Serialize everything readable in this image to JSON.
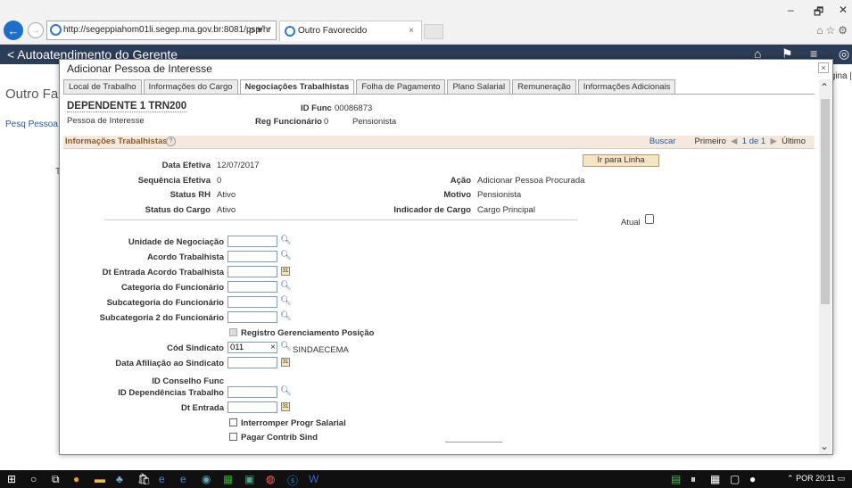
{
  "browser": {
    "url": "http://segeppiahom01li.segep.ma.gov.br:8081/psp/hr",
    "tab_title": "Outro Favorecido",
    "tab_close": "×",
    "address_controls": "ρ ▾ ♂",
    "minimize": "–",
    "restore": "🗗",
    "close": "✕",
    "toolbar_icons": "⌂☆⚙"
  },
  "app": {
    "header_title": "< Autoatendimento do Gerente",
    "behind_title": "Outro Fa",
    "behind_link": "Pesq Pessoa",
    "behind_right": "gina |",
    "behind_t": "T"
  },
  "modal": {
    "title": "Adicionar Pessoa de Interesse",
    "close": "×",
    "tabs": [
      {
        "label": "Local de Trabalho"
      },
      {
        "label": "Informações do Cargo"
      },
      {
        "label": "Negociações Trabalhistas"
      },
      {
        "label": "Folha de Pagamento"
      },
      {
        "label": "Plano Salarial"
      },
      {
        "label": "Remuneração"
      },
      {
        "label": "Informações Adicionais"
      }
    ],
    "person_name": "DEPENDENTE 1 TRN200",
    "person_type": "Pessoa de Interesse",
    "id_func_label": "ID Func",
    "id_func_value": "00086873",
    "reg_func_label": "Reg Funcionário",
    "reg_func_value": "0",
    "reg_func_extra": "Pensionista",
    "section": {
      "title": "Informações Trabalhistas",
      "help": "?",
      "buscar": "Buscar",
      "primeiro": "Primeiro",
      "counter": "1 de 1",
      "ultimo": "Último"
    },
    "ir_para_linha": "Ir para Linha",
    "fields": {
      "data_efetiva_label": "Data Efetiva",
      "data_efetiva_value": "12/07/2017",
      "seq_efetiva_label": "Sequência Efetiva",
      "seq_efetiva_value": "0",
      "status_rh_label": "Status RH",
      "status_rh_value": "Ativo",
      "status_cargo_label": "Status do Cargo",
      "status_cargo_value": "Ativo",
      "acao_label": "Ação",
      "acao_value": "Adicionar Pessoa Procurada",
      "motivo_label": "Motivo",
      "motivo_value": "Pensionista",
      "indicador_label": "Indicador de Cargo",
      "indicador_value": "Cargo Principal",
      "atual_label": "Atual",
      "unidade_neg_label": "Unidade de Negociação",
      "acordo_label": "Acordo Trabalhista",
      "dt_entrada_acordo_label": "Dt Entrada Acordo Trabalhista",
      "categoria_label": "Categoria do Funcionário",
      "subcategoria_label": "Subcategoria do Funcionário",
      "subcategoria2_label": "Subcategoria 2 do Funcionário",
      "registro_label": "Registro Gerenciamento Posição",
      "cod_sindicato_label": "Cód Sindicato",
      "cod_sindicato_value": "011",
      "sindicato_name": "SINDAECEMA",
      "data_afiliacao_label": "Data Afiliação ao Sindicato",
      "id_conselho_label": "ID Conselho Func",
      "id_dependencias_label": "ID Dependências Trabalho",
      "dt_entrada_label": "Dt Entrada",
      "interromper_label": "Interromper Progr Salarial",
      "pagar_label": "Pagar Contrib Sind",
      "clear_x": "×"
    }
  },
  "taskbar": {
    "lang": "POR",
    "time": "20:11"
  }
}
